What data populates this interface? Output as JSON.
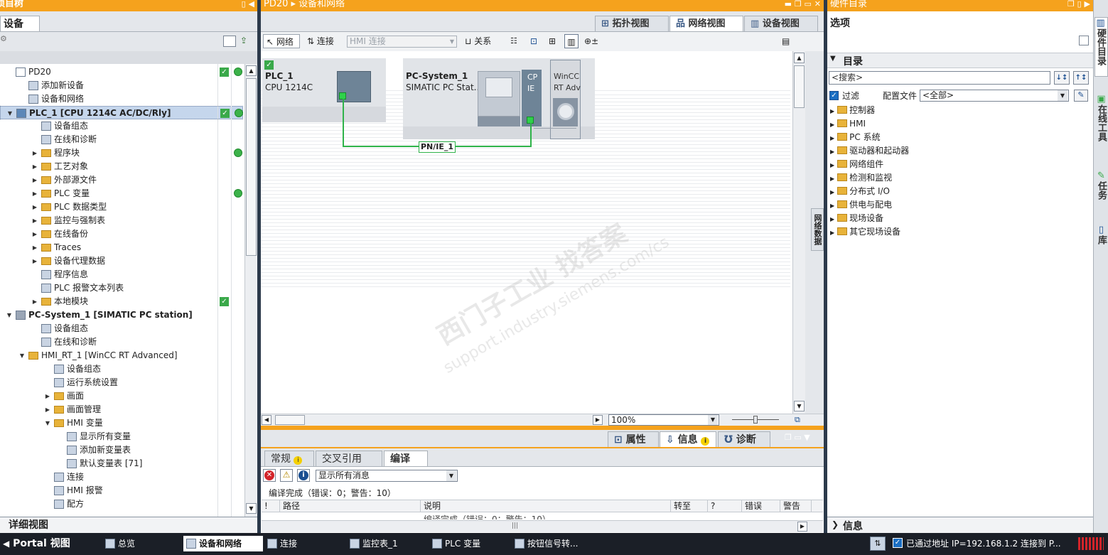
{
  "left_panel": {
    "title": "项目树",
    "tab": "设备",
    "tree": [
      {
        "label": "PD20",
        "indent": 0,
        "arrow": "",
        "icon": "document-icon",
        "check": true,
        "dot": true,
        "selected": false
      },
      {
        "label": "添加新设备",
        "indent": 1,
        "arrow": "",
        "icon": "add-device-icon",
        "check": false,
        "dot": false,
        "selected": false
      },
      {
        "label": "设备和网络",
        "indent": 1,
        "arrow": "",
        "icon": "network-icon",
        "check": false,
        "dot": false,
        "selected": false
      },
      {
        "label": "PLC_1 [CPU 1214C AC/DC/Rly]",
        "indent": 0,
        "arrow": "down",
        "icon": "plc-icon",
        "check": true,
        "dot": true,
        "selected": true
      },
      {
        "label": "设备组态",
        "indent": 2,
        "arrow": "",
        "icon": "device-config-icon",
        "check": false,
        "dot": false,
        "selected": false
      },
      {
        "label": "在线和诊断",
        "indent": 2,
        "arrow": "",
        "icon": "diagnostics-icon",
        "check": false,
        "dot": false,
        "selected": false
      },
      {
        "label": "程序块",
        "indent": 2,
        "arrow": "right",
        "icon": "folder-icon",
        "check": false,
        "dot": true,
        "selected": false
      },
      {
        "label": "工艺对象",
        "indent": 2,
        "arrow": "right",
        "icon": "folder-icon",
        "check": false,
        "dot": false,
        "selected": false
      },
      {
        "label": "外部源文件",
        "indent": 2,
        "arrow": "right",
        "icon": "folder-icon",
        "check": false,
        "dot": false,
        "selected": false
      },
      {
        "label": "PLC 变量",
        "indent": 2,
        "arrow": "right",
        "icon": "folder-icon",
        "check": false,
        "dot": true,
        "selected": false
      },
      {
        "label": "PLC 数据类型",
        "indent": 2,
        "arrow": "right",
        "icon": "folder-icon",
        "check": false,
        "dot": false,
        "selected": false
      },
      {
        "label": "监控与强制表",
        "indent": 2,
        "arrow": "right",
        "icon": "folder-icon",
        "check": false,
        "dot": false,
        "selected": false
      },
      {
        "label": "在线备份",
        "indent": 2,
        "arrow": "right",
        "icon": "folder-icon",
        "check": false,
        "dot": false,
        "selected": false
      },
      {
        "label": "Traces",
        "indent": 2,
        "arrow": "right",
        "icon": "folder-icon",
        "check": false,
        "dot": false,
        "selected": false
      },
      {
        "label": "设备代理数据",
        "indent": 2,
        "arrow": "right",
        "icon": "folder-icon",
        "check": false,
        "dot": false,
        "selected": false
      },
      {
        "label": "程序信息",
        "indent": 2,
        "arrow": "",
        "icon": "program-info-icon",
        "check": false,
        "dot": false,
        "selected": false
      },
      {
        "label": "PLC 报警文本列表",
        "indent": 2,
        "arrow": "",
        "icon": "alarm-text-icon",
        "check": false,
        "dot": false,
        "selected": false
      },
      {
        "label": "本地模块",
        "indent": 2,
        "arrow": "right",
        "icon": "folder-icon",
        "check": true,
        "dot": false,
        "selected": false
      },
      {
        "label": "PC-System_1 [SIMATIC PC station]",
        "indent": 0,
        "arrow": "down",
        "icon": "pc-icon",
        "check": false,
        "dot": false,
        "selected": false
      },
      {
        "label": "设备组态",
        "indent": 2,
        "arrow": "",
        "icon": "device-config-icon",
        "check": false,
        "dot": false,
        "selected": false
      },
      {
        "label": "在线和诊断",
        "indent": 2,
        "arrow": "",
        "icon": "diagnostics-icon",
        "check": false,
        "dot": false,
        "selected": false
      },
      {
        "label": "HMI_RT_1 [WinCC RT Advanced]",
        "indent": 1,
        "arrow": "down",
        "icon": "folder-icon",
        "check": false,
        "dot": false,
        "selected": false
      },
      {
        "label": "设备组态",
        "indent": 3,
        "arrow": "",
        "icon": "device-config-icon",
        "check": false,
        "dot": false,
        "selected": false
      },
      {
        "label": "运行系统设置",
        "indent": 3,
        "arrow": "",
        "icon": "settings-icon",
        "check": false,
        "dot": false,
        "selected": false
      },
      {
        "label": "画面",
        "indent": 3,
        "arrow": "right",
        "icon": "folder-icon",
        "check": false,
        "dot": false,
        "selected": false
      },
      {
        "label": "画面管理",
        "indent": 3,
        "arrow": "right",
        "icon": "folder-icon",
        "check": false,
        "dot": false,
        "selected": false
      },
      {
        "label": "HMI 变量",
        "indent": 3,
        "arrow": "down",
        "icon": "folder-icon",
        "check": false,
        "dot": false,
        "selected": false
      },
      {
        "label": "显示所有变量",
        "indent": 4,
        "arrow": "",
        "icon": "tag-table-icon",
        "check": false,
        "dot": false,
        "selected": false
      },
      {
        "label": "添加新变量表",
        "indent": 4,
        "arrow": "",
        "icon": "add-tag-table-icon",
        "check": false,
        "dot": false,
        "selected": false
      },
      {
        "label": "默认变量表 [71]",
        "indent": 4,
        "arrow": "",
        "icon": "tag-table-icon",
        "check": false,
        "dot": false,
        "selected": false
      },
      {
        "label": "连接",
        "indent": 3,
        "arrow": "",
        "icon": "connection-icon",
        "check": false,
        "dot": false,
        "selected": false
      },
      {
        "label": "HMI 报警",
        "indent": 3,
        "arrow": "",
        "icon": "alarm-icon",
        "check": false,
        "dot": false,
        "selected": false
      },
      {
        "label": "配方",
        "indent": 3,
        "arrow": "",
        "icon": "recipe-icon",
        "check": false,
        "dot": false,
        "selected": false
      }
    ],
    "details_view": "详细视图",
    "portal_view": "Portal 视图"
  },
  "editor": {
    "title": "PD20 ▸ 设备和网络",
    "view_tabs": [
      "拓扑视图",
      "网络视图",
      "设备视图"
    ],
    "active_view_tab": "网络视图",
    "toolbar": {
      "network": "网络",
      "connect": "连接",
      "hmi_connect": "HMI 连接",
      "relations": "关系"
    },
    "devices": {
      "plc_name": "PLC_1",
      "plc_type": "CPU 1214C",
      "pc_name": "PC-System_1",
      "pc_type": "SIMATIC PC Stat...",
      "cp_label_1": "CP",
      "cp_label_2": "IE",
      "wincc_label_1": "WinCC",
      "wincc_label_2": "RT Adv"
    },
    "network_label": "PN/IE_1",
    "side_tab": "网络数据",
    "zoom": "100%",
    "watermark_1": "西门子工业  找答案",
    "watermark_2": "support.industry.siemens.com/cs"
  },
  "inspector": {
    "tabs": [
      "属性",
      "信息",
      "诊断"
    ],
    "active_tab": "信息",
    "subtabs": [
      "常规",
      "交叉引用",
      "编译"
    ],
    "active_subtab": "编译",
    "filter": "显示所有消息",
    "summary": "编译完成（错误：0；警告：10）",
    "columns": [
      "!",
      "路径",
      "说明",
      "转至",
      "?",
      "错误",
      "警告"
    ],
    "partial_row": "编译完成（错误：0；警告：10）"
  },
  "right_panel": {
    "title": "硬件目录",
    "options": "选项",
    "catalog": "目录",
    "search_placeholder": "<搜索>",
    "filter_label": "过滤",
    "profile_label": "配置文件",
    "profile_value": "<全部>",
    "categories": [
      "控制器",
      "HMI",
      "PC 系统",
      "驱动器和起动器",
      "网络组件",
      "检测和监视",
      "分布式 I/O",
      "供电与配电",
      "现场设备",
      "其它现场设备"
    ],
    "info": "信息",
    "vertical_tabs": [
      "硬件目录",
      "在线工具",
      "任务",
      "库"
    ]
  },
  "taskbar": {
    "items": [
      "总览",
      "设备和网络",
      "连接",
      "监控表_1",
      "PLC 变量",
      "按钮信号转..."
    ],
    "active": "设备和网络",
    "status": "已通过地址 IP=192.168.1.2 连接到 P..."
  },
  "colors": {
    "accent": "#f5a21d",
    "ok_green": "#3aa94a",
    "network_line": "#2fb34a",
    "selected_row": "#c5d6ec"
  }
}
